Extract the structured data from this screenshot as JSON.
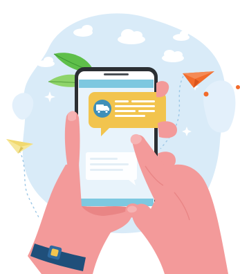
{
  "colors": {
    "background_blob": "#d9ebf8",
    "cloud": "#ffffff",
    "leaf_dark": "#5fbf4a",
    "leaf_light": "#8fd46a",
    "paper_plane_orange": "#f26b2b",
    "paper_plane_yellow": "#f6e79a",
    "phone_body": "#2b2f33",
    "screen_header": "#7dc8e0",
    "screen": "#e8f3fb",
    "chat_bubble": "#f2c44e",
    "chat_icon_bg": "#3f8fb8",
    "skin": "#f39a9a",
    "skin_shadow": "#e98585",
    "watch_band": "#1f4f7a"
  },
  "icons": {
    "chat_icon": "delivery-truck-icon",
    "decor_1": "paper-plane-icon",
    "decor_2": "paper-plane-icon",
    "decor_3": "leaf-icon",
    "decor_4": "sparkle-icon"
  }
}
